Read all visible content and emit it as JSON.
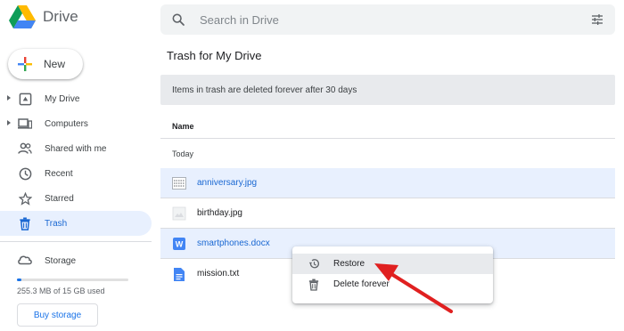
{
  "app": {
    "title": "Drive"
  },
  "search": {
    "placeholder": "Search in Drive"
  },
  "sidebar": {
    "new_label": "New",
    "items": [
      {
        "label": "My Drive",
        "icon": "my-drive-icon",
        "expandable": true
      },
      {
        "label": "Computers",
        "icon": "computers-icon",
        "expandable": true
      },
      {
        "label": "Shared with me",
        "icon": "shared-icon",
        "expandable": false
      },
      {
        "label": "Recent",
        "icon": "clock-icon",
        "expandable": false
      },
      {
        "label": "Starred",
        "icon": "star-icon",
        "expandable": false
      },
      {
        "label": "Trash",
        "icon": "trash-icon",
        "expandable": false,
        "active": true
      }
    ],
    "storage_label": "Storage",
    "storage_used_text": "255.3 MB of 15 GB used",
    "storage_fraction": 0.017,
    "buy_storage_label": "Buy storage"
  },
  "main": {
    "title": "Trash for My Drive",
    "banner": "Items in trash are deleted forever after 30 days",
    "column_name": "Name",
    "group": "Today",
    "files": [
      {
        "name": "anniversary.jpg",
        "icon": "image-file-icon",
        "selected": true
      },
      {
        "name": "birthday.jpg",
        "icon": "image-file-icon",
        "selected": false
      },
      {
        "name": "smartphones.docx",
        "icon": "word-doc-icon",
        "selected": true
      },
      {
        "name": "mission.txt",
        "icon": "text-file-icon",
        "selected": false
      }
    ]
  },
  "context_menu": {
    "items": [
      {
        "label": "Restore",
        "icon": "restore-icon",
        "hovered": true
      },
      {
        "label": "Delete forever",
        "icon": "trash-icon",
        "hovered": false
      }
    ]
  },
  "colors": {
    "accent": "#1a73e8",
    "selected_bg": "#e8f0fe",
    "annotation_arrow": "#e02020"
  }
}
